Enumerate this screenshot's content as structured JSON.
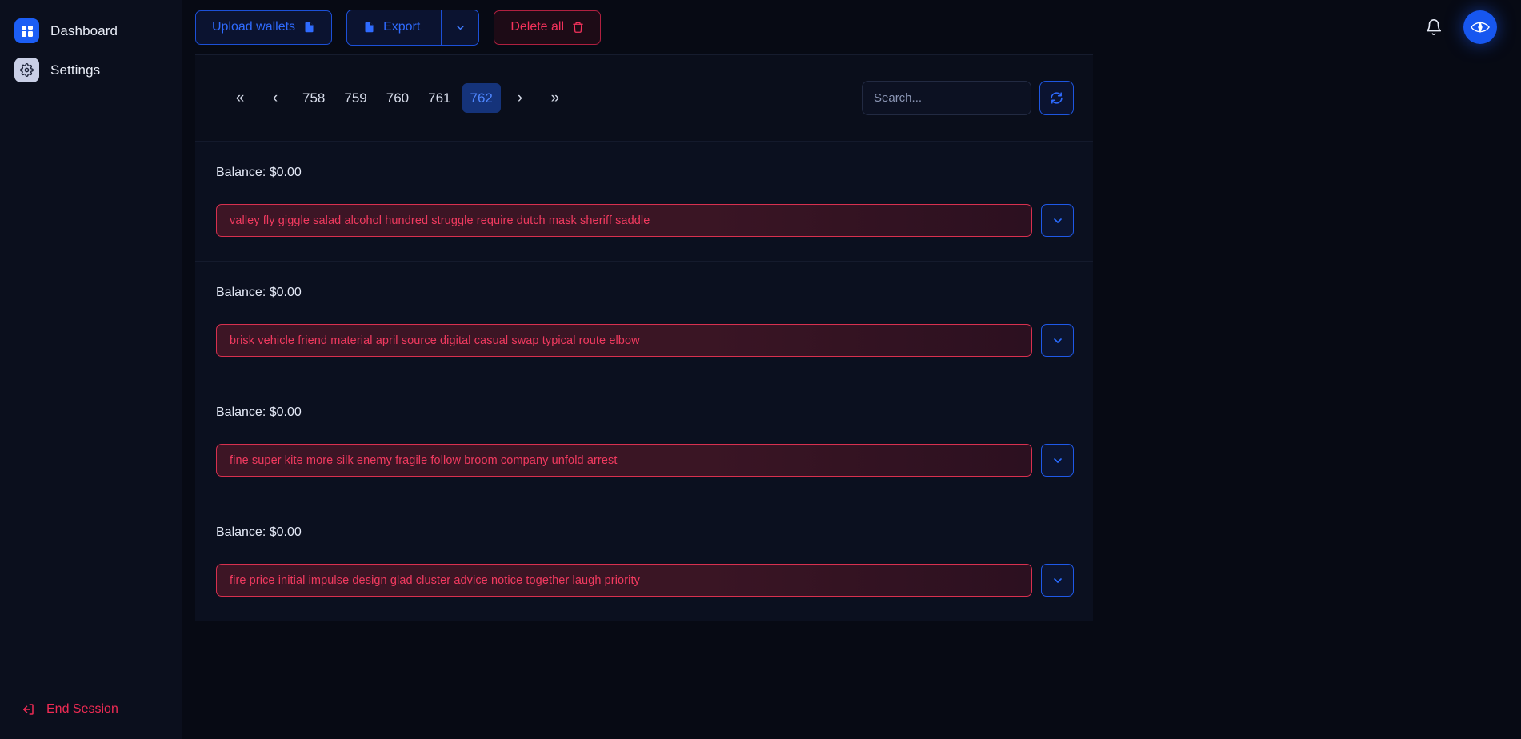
{
  "sidebar": {
    "items": [
      {
        "label": "Dashboard",
        "icon": "grid-icon",
        "active": true
      },
      {
        "label": "Settings",
        "icon": "gear-icon",
        "active": false
      }
    ],
    "end_session": {
      "label": "End Session",
      "icon": "logout-icon",
      "color": "#ef2b54"
    }
  },
  "toolbar": {
    "upload_label": "Upload wallets",
    "upload_icon": "file-upload-icon",
    "export_label": "Export",
    "export_icon": "document-icon",
    "export_caret_icon": "chevron-down-icon",
    "delete_label": "Delete all",
    "delete_icon": "trash-icon",
    "bell_icon": "bell-icon",
    "avatar_icon": "eye-avatar-icon",
    "colors": {
      "accent_blue": "#2f6bff",
      "danger_red": "#f5325c",
      "avatar_bg": "#1757f0"
    }
  },
  "pagination": {
    "first_icon": "chevrons-left-icon",
    "prev_icon": "chevron-left-icon",
    "next_icon": "chevron-right-icon",
    "last_icon": "chevrons-right-icon",
    "pages": [
      "758",
      "759",
      "760",
      "761",
      "762"
    ],
    "active_page": "762"
  },
  "search": {
    "placeholder": "Search...",
    "value": "",
    "refresh_icon": "refresh-icon"
  },
  "wallets": [
    {
      "balance": "Balance: $0.00",
      "phrase": "valley fly giggle salad alcohol hundred struggle require dutch mask sheriff saddle",
      "caret_icon": "chevron-down-icon"
    },
    {
      "balance": "Balance: $0.00",
      "phrase": "brisk vehicle friend material april source digital casual swap typical route elbow",
      "caret_icon": "chevron-down-icon"
    },
    {
      "balance": "Balance: $0.00",
      "phrase": "fine super kite more silk enemy fragile follow broom company unfold arrest",
      "caret_icon": "chevron-down-icon"
    },
    {
      "balance": "Balance: $0.00",
      "phrase": "fire price initial impulse design glad cluster advice notice together laugh priority",
      "caret_icon": "chevron-down-icon"
    }
  ]
}
